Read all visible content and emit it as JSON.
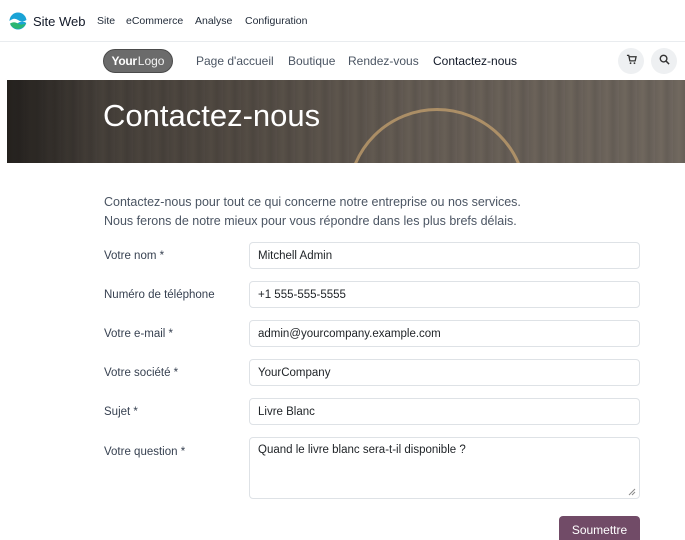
{
  "admin_bar": {
    "app_name": "Site Web",
    "menus": [
      "Site",
      "eCommerce",
      "Analyse",
      "Configuration"
    ]
  },
  "header": {
    "logo_bold": "Your",
    "logo_light": "Logo",
    "nav": [
      "Page d'accueil",
      "Boutique",
      "Rendez-vous",
      "Contactez-nous"
    ],
    "active_nav": "Contactez-nous",
    "cart_icon": "cart-icon",
    "search_icon": "search-icon"
  },
  "banner": {
    "title": "Contactez-nous"
  },
  "intro": {
    "line1": "Contactez-nous pour tout ce qui concerne notre entreprise ou nos services.",
    "line2": "Nous ferons de notre mieux pour vous répondre dans les plus brefs délais."
  },
  "form": {
    "name_label": "Votre nom *",
    "name_value": "Mitchell Admin",
    "phone_label": "Numéro de téléphone",
    "phone_value": "+1 555-555-5555",
    "email_label": "Votre e-mail *",
    "email_value": "admin@yourcompany.example.com",
    "company_label": "Votre société *",
    "company_value": "YourCompany",
    "subject_label": "Sujet *",
    "subject_value": "Livre Blanc",
    "question_label": "Votre question *",
    "question_value": "Quand le livre blanc sera-t-il disponible ?",
    "submit_label": "Soumettre"
  },
  "colors": {
    "accent": "#714b67",
    "app_icon_blue": "#1aa3d6",
    "app_icon_green": "#2bb673"
  }
}
